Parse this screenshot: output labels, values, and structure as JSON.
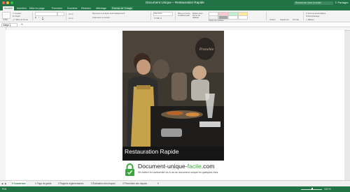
{
  "window": {
    "title": "Document Unique – Restauration Rapide",
    "search_placeholder": "Rechercher dans la feuille",
    "share_label": "Partager",
    "traffic_colors": [
      "#ff5f57",
      "#febc2e",
      "#28c840"
    ]
  },
  "ribbon_tabs": [
    {
      "label": "Accueil",
      "state": "active"
    },
    {
      "label": "Insertion",
      "state": "normal"
    },
    {
      "label": "Mise en page",
      "state": "normal"
    },
    {
      "label": "Formules",
      "state": "normal"
    },
    {
      "label": "Données",
      "state": "normal"
    },
    {
      "label": "Révision",
      "state": "normal"
    },
    {
      "label": "Affichage",
      "state": "normal"
    },
    {
      "label": "Format de l'image",
      "state": "context"
    }
  ],
  "ribbon": {
    "coller": "Coller",
    "couper": "Couper",
    "copier": "Copier",
    "mise_en_forme": "Mise en forme",
    "renvoyer_ligne": "Renvoyer à la ligne automatiquement",
    "fusionner": "Fusionner et centrer",
    "standard": "Standard",
    "mise_en_forme_cond": "Mise en forme conditionnelle",
    "mettre_tableau": "Mettre sous forme de tableau",
    "styles_cellules": "Styles de cellules",
    "inserer": "Insérer",
    "supprimer": "Supprimer",
    "format": "Format",
    "somme": "Somme automatique",
    "remplissage": "Remplissage",
    "effacer": "Effacer",
    "trier": "Trier et filtrer",
    "rechercher": "Rechercher et sélectionner"
  },
  "formula_bar": {
    "namebox": "Image 1",
    "fx": "fx"
  },
  "cover": {
    "title": "Restauration Rapide",
    "brand_a": "Document-unique-",
    "brand_b": "facile",
    "brand_c": ".com",
    "tagline": "Se mettre en conformité vis à vis du document unique en quelques clics.",
    "accent": "#3aa83a"
  },
  "sheet_tabs": [
    {
      "label": "0 Couverture",
      "active": true
    },
    {
      "label": "1 Page de garde",
      "active": false
    },
    {
      "label": "2 Rappels réglementaires",
      "active": false
    },
    {
      "label": "3 Évaluation des risques",
      "active": false
    },
    {
      "label": "4 Prévention des risques",
      "active": false
    }
  ],
  "status": {
    "left": "Prêt",
    "zoom": "100 %",
    "zoom_level": 0.5
  }
}
